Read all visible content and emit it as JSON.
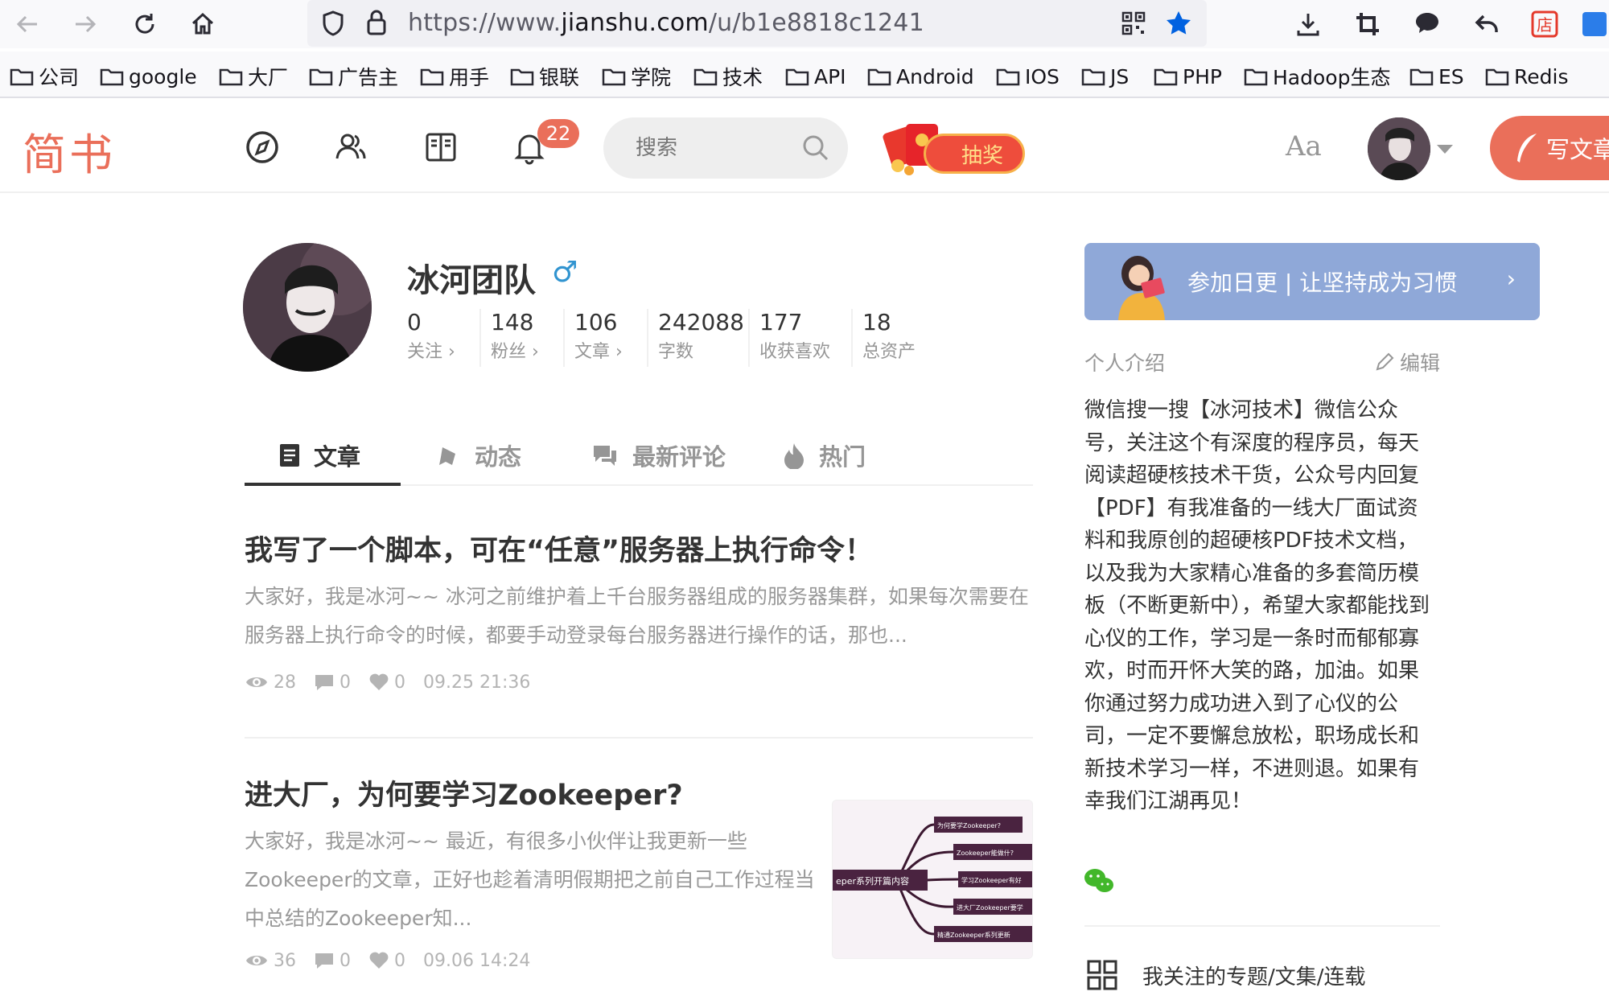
{
  "browser": {
    "url_prefix": "https://www.",
    "url_domain": "jianshu.com",
    "url_path": "/u/b1e8818c1241"
  },
  "bookmarks": [
    "公司",
    "google",
    "大厂",
    "广告主",
    "用手",
    "银联",
    "学院",
    "技术",
    "API",
    "Android",
    "IOS",
    "JS",
    "PHP",
    "Hadoop生态",
    "ES",
    "Redis"
  ],
  "header": {
    "logo": "简书",
    "notification_count": "22",
    "search_placeholder": "搜索",
    "lottery_label": "抽奖",
    "font_toggle": "Aa",
    "write_label": "写文章",
    "accent_color": "#ea6f5a"
  },
  "profile": {
    "name": "冰河团队",
    "gender_symbol": "♂",
    "stats": [
      {
        "value": "0",
        "label": "关注 ›"
      },
      {
        "value": "148",
        "label": "粉丝 ›"
      },
      {
        "value": "106",
        "label": "文章 ›"
      },
      {
        "value": "242088",
        "label": "字数"
      },
      {
        "value": "177",
        "label": "收获喜欢"
      },
      {
        "value": "18",
        "label": "总资产"
      }
    ]
  },
  "tabs": [
    {
      "label": "文章",
      "icon": "article-icon",
      "active": true
    },
    {
      "label": "动态",
      "icon": "bell-icon"
    },
    {
      "label": "最新评论",
      "icon": "comments-icon"
    },
    {
      "label": "热门",
      "icon": "fire-icon"
    }
  ],
  "articles": [
    {
      "title": "我写了一个脚本，可在“任意”服务器上执行命令！",
      "abstract": "大家好，我是冰河~~ 冰河之前维护着上千台服务器组成的服务器集群，如果每次需要在服务器上执行命令的时候，都要手动登录每台服务器进行操作的话，那也...",
      "views": "28",
      "comments": "0",
      "likes": "0",
      "time": "09.25 21:36"
    },
    {
      "title": "进大厂，为何要学习Zookeeper?",
      "abstract": "大家好，我是冰河~~ 最近，有很多小伙伴让我更新一些Zookeeper的文章，正好也趁着清明假期把之前自己工作过程当中总结的Zookeeper知...",
      "views": "36",
      "comments": "0",
      "likes": "0",
      "time": "09.06 14:24",
      "thumb": {
        "center": "eper系列开篇内容",
        "nodes": [
          "为何要学Zookeeper?",
          "Zookeeper能做什?",
          "学习Zookeeper有好",
          "进大厂Zookeeper要学",
          "精通Zookeeper系列更新"
        ]
      }
    }
  ],
  "sidebar": {
    "banner_text": "参加日更 | 让坚持成为习惯",
    "banner_arrow": "›",
    "intro_title": "个人介绍",
    "edit_label": "编辑",
    "intro_text": "微信搜一搜【冰河技术】微信公众号，关注这个有深度的程序员，每天阅读超硬核技术干货，公众号内回复【PDF】有我准备的一线大厂面试资料和我原创的超硬核PDF技术文档，以及我为大家精心准备的多套简历模板（不断更新中），希望大家都能找到心仪的工作，学习是一条时而郁郁寡欢，时而开怀大笑的路，加油。如果你通过努力成功进入到了心仪的公司，一定不要懈怠放松，职场成长和新技术学习一样，不进则退。如果有幸我们江湖再见！",
    "follow_topics": "我关注的专题/文集/连载"
  }
}
